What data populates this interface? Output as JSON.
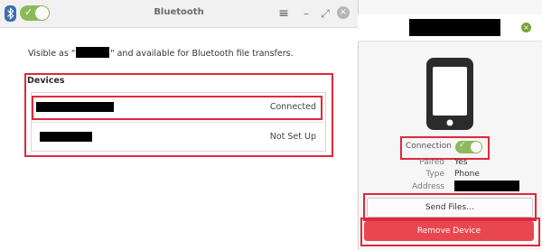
{
  "window": {
    "title": "Bluetooth",
    "bluetooth_enabled": true,
    "menu_icon": "hamburger-menu-icon",
    "minimize_label": "–",
    "maximize_label": "⤢",
    "close_label": "×"
  },
  "visibility": {
    "prefix": "Visible as \"",
    "suffix": "\" and available for Bluetooth file transfers."
  },
  "devices": {
    "heading": "Devices",
    "items": [
      {
        "status": "Connected"
      },
      {
        "status": "Not Set Up"
      }
    ]
  },
  "popover": {
    "connection_label": "Connection",
    "connection_on": true,
    "paired_label": "Paired",
    "paired_value": "Yes",
    "type_label": "Type",
    "type_value": "Phone",
    "address_label": "Address",
    "send_files_label": "Send Files…",
    "remove_device_label": "Remove Device"
  },
  "colors": {
    "accent_green": "#8cba5a",
    "highlight_red": "#e0283a",
    "remove_button": "#e8474f"
  }
}
